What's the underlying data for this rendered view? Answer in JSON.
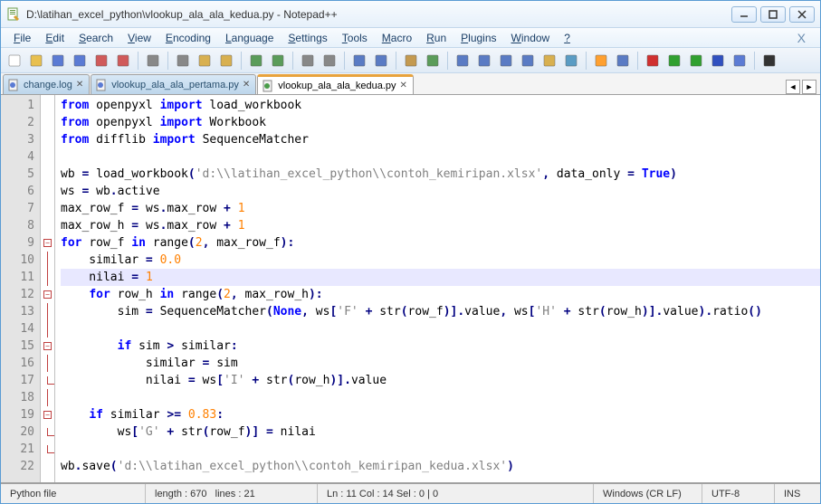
{
  "title": "D:\\latihan_excel_python\\vlookup_ala_ala_kedua.py - Notepad++",
  "menu": [
    "File",
    "Edit",
    "Search",
    "View",
    "Encoding",
    "Language",
    "Settings",
    "Tools",
    "Macro",
    "Run",
    "Plugins",
    "Window",
    "?"
  ],
  "tabs": [
    {
      "label": "change.log",
      "active": false
    },
    {
      "label": "vlookup_ala_ala_pertama.py",
      "active": false
    },
    {
      "label": "vlookup_ala_ala_kedua.py",
      "active": true
    }
  ],
  "code_lines": [
    [
      {
        "t": "from ",
        "c": "kw"
      },
      {
        "t": "openpyxl ",
        "c": "id"
      },
      {
        "t": "import ",
        "c": "kw"
      },
      {
        "t": "load_workbook",
        "c": "id"
      }
    ],
    [
      {
        "t": "from ",
        "c": "kw"
      },
      {
        "t": "openpyxl ",
        "c": "id"
      },
      {
        "t": "import ",
        "c": "kw"
      },
      {
        "t": "Workbook",
        "c": "id"
      }
    ],
    [
      {
        "t": "from ",
        "c": "kw"
      },
      {
        "t": "difflib ",
        "c": "id"
      },
      {
        "t": "import ",
        "c": "kw"
      },
      {
        "t": "SequenceMatcher",
        "c": "id"
      }
    ],
    [],
    [
      {
        "t": "wb ",
        "c": "id"
      },
      {
        "t": "= ",
        "c": "op"
      },
      {
        "t": "load_workbook",
        "c": "id"
      },
      {
        "t": "(",
        "c": "op"
      },
      {
        "t": "'d:\\\\latihan_excel_python\\\\contoh_kemiripan.xlsx'",
        "c": "str"
      },
      {
        "t": ", ",
        "c": "op"
      },
      {
        "t": "data_only ",
        "c": "id"
      },
      {
        "t": "= ",
        "c": "op"
      },
      {
        "t": "True",
        "c": "kw"
      },
      {
        "t": ")",
        "c": "op"
      }
    ],
    [
      {
        "t": "ws ",
        "c": "id"
      },
      {
        "t": "= ",
        "c": "op"
      },
      {
        "t": "wb",
        "c": "id"
      },
      {
        "t": ".",
        "c": "op"
      },
      {
        "t": "active",
        "c": "id"
      }
    ],
    [
      {
        "t": "max_row_f ",
        "c": "id"
      },
      {
        "t": "= ",
        "c": "op"
      },
      {
        "t": "ws",
        "c": "id"
      },
      {
        "t": ".",
        "c": "op"
      },
      {
        "t": "max_row ",
        "c": "id"
      },
      {
        "t": "+ ",
        "c": "op"
      },
      {
        "t": "1",
        "c": "num"
      }
    ],
    [
      {
        "t": "max_row_h ",
        "c": "id"
      },
      {
        "t": "= ",
        "c": "op"
      },
      {
        "t": "ws",
        "c": "id"
      },
      {
        "t": ".",
        "c": "op"
      },
      {
        "t": "max_row ",
        "c": "id"
      },
      {
        "t": "+ ",
        "c": "op"
      },
      {
        "t": "1",
        "c": "num"
      }
    ],
    [
      {
        "t": "for ",
        "c": "kw"
      },
      {
        "t": "row_f ",
        "c": "id"
      },
      {
        "t": "in ",
        "c": "kw"
      },
      {
        "t": "range",
        "c": "id"
      },
      {
        "t": "(",
        "c": "op"
      },
      {
        "t": "2",
        "c": "num"
      },
      {
        "t": ", ",
        "c": "op"
      },
      {
        "t": "max_row_f",
        "c": "id"
      },
      {
        "t": "):",
        "c": "op"
      }
    ],
    [
      {
        "t": "    similar ",
        "c": "id"
      },
      {
        "t": "= ",
        "c": "op"
      },
      {
        "t": "0.0",
        "c": "num"
      }
    ],
    [
      {
        "t": "    nilai ",
        "c": "id"
      },
      {
        "t": "= ",
        "c": "op"
      },
      {
        "t": "1",
        "c": "num"
      }
    ],
    [
      {
        "t": "    ",
        "c": "id"
      },
      {
        "t": "for ",
        "c": "kw"
      },
      {
        "t": "row_h ",
        "c": "id"
      },
      {
        "t": "in ",
        "c": "kw"
      },
      {
        "t": "range",
        "c": "id"
      },
      {
        "t": "(",
        "c": "op"
      },
      {
        "t": "2",
        "c": "num"
      },
      {
        "t": ", ",
        "c": "op"
      },
      {
        "t": "max_row_h",
        "c": "id"
      },
      {
        "t": "):",
        "c": "op"
      }
    ],
    [
      {
        "t": "        sim ",
        "c": "id"
      },
      {
        "t": "= ",
        "c": "op"
      },
      {
        "t": "SequenceMatcher",
        "c": "id"
      },
      {
        "t": "(",
        "c": "op"
      },
      {
        "t": "None",
        "c": "kw"
      },
      {
        "t": ", ",
        "c": "op"
      },
      {
        "t": "ws",
        "c": "id"
      },
      {
        "t": "[",
        "c": "op"
      },
      {
        "t": "'F'",
        "c": "str"
      },
      {
        "t": " + ",
        "c": "op"
      },
      {
        "t": "str",
        "c": "id"
      },
      {
        "t": "(",
        "c": "op"
      },
      {
        "t": "row_f",
        "c": "id"
      },
      {
        "t": ")].",
        "c": "op"
      },
      {
        "t": "value",
        "c": "id"
      },
      {
        "t": ", ",
        "c": "op"
      },
      {
        "t": "ws",
        "c": "id"
      },
      {
        "t": "[",
        "c": "op"
      },
      {
        "t": "'H'",
        "c": "str"
      },
      {
        "t": " + ",
        "c": "op"
      },
      {
        "t": "str",
        "c": "id"
      },
      {
        "t": "(",
        "c": "op"
      },
      {
        "t": "row_h",
        "c": "id"
      },
      {
        "t": ")].",
        "c": "op"
      },
      {
        "t": "value",
        "c": "id"
      },
      {
        "t": ").",
        "c": "op"
      },
      {
        "t": "ratio",
        "c": "id"
      },
      {
        "t": "()",
        "c": "op"
      }
    ],
    [],
    [
      {
        "t": "        ",
        "c": "id"
      },
      {
        "t": "if ",
        "c": "kw"
      },
      {
        "t": "sim ",
        "c": "id"
      },
      {
        "t": "> ",
        "c": "op"
      },
      {
        "t": "similar",
        "c": "id"
      },
      {
        "t": ":",
        "c": "op"
      }
    ],
    [
      {
        "t": "            similar ",
        "c": "id"
      },
      {
        "t": "= ",
        "c": "op"
      },
      {
        "t": "sim",
        "c": "id"
      }
    ],
    [
      {
        "t": "            nilai ",
        "c": "id"
      },
      {
        "t": "= ",
        "c": "op"
      },
      {
        "t": "ws",
        "c": "id"
      },
      {
        "t": "[",
        "c": "op"
      },
      {
        "t": "'I'",
        "c": "str"
      },
      {
        "t": " + ",
        "c": "op"
      },
      {
        "t": "str",
        "c": "id"
      },
      {
        "t": "(",
        "c": "op"
      },
      {
        "t": "row_h",
        "c": "id"
      },
      {
        "t": ")].",
        "c": "op"
      },
      {
        "t": "value",
        "c": "id"
      }
    ],
    [],
    [
      {
        "t": "    ",
        "c": "id"
      },
      {
        "t": "if ",
        "c": "kw"
      },
      {
        "t": "similar ",
        "c": "id"
      },
      {
        "t": ">= ",
        "c": "op"
      },
      {
        "t": "0.83",
        "c": "num"
      },
      {
        "t": ":",
        "c": "op"
      }
    ],
    [
      {
        "t": "        ws",
        "c": "id"
      },
      {
        "t": "[",
        "c": "op"
      },
      {
        "t": "'G'",
        "c": "str"
      },
      {
        "t": " + ",
        "c": "op"
      },
      {
        "t": "str",
        "c": "id"
      },
      {
        "t": "(",
        "c": "op"
      },
      {
        "t": "row_f",
        "c": "id"
      },
      {
        "t": ")]",
        "c": "op"
      },
      {
        "t": " = ",
        "c": "op"
      },
      {
        "t": "nilai",
        "c": "id"
      }
    ],
    [],
    [
      {
        "t": "wb",
        "c": "id"
      },
      {
        "t": ".",
        "c": "op"
      },
      {
        "t": "save",
        "c": "id"
      },
      {
        "t": "(",
        "c": "op"
      },
      {
        "t": "'d:\\\\latihan_excel_python\\\\contoh_kemiripan_kedua.xlsx'",
        "c": "str"
      },
      {
        "t": ")",
        "c": "op"
      }
    ]
  ],
  "fold": {
    "9": "box",
    "10": "line",
    "11": "line",
    "12": "box",
    "13": "line",
    "14": "line",
    "15": "box",
    "16": "line",
    "17": "end",
    "18": "line",
    "19": "box",
    "20": "end",
    "21": "end"
  },
  "current_line": 11,
  "status": {
    "lang": "Python file",
    "length": "length : 670",
    "lines": "lines : 21",
    "pos": "Ln : 11    Col : 14    Sel : 0 | 0",
    "eol": "Windows (CR LF)",
    "enc": "UTF-8",
    "ins": "INS"
  },
  "toolbar_icons": [
    "new",
    "open",
    "save",
    "saveall",
    "close",
    "closeall",
    "print",
    "cut",
    "copy",
    "paste",
    "undo",
    "redo",
    "find",
    "replace",
    "zoomin",
    "zoomout",
    "sync",
    "wrap",
    "showall",
    "indent",
    "foldall",
    "unfold",
    "dir",
    "showws",
    "func",
    "doc",
    "rec",
    "play",
    "playfast",
    "stop",
    "save2",
    "abc"
  ]
}
